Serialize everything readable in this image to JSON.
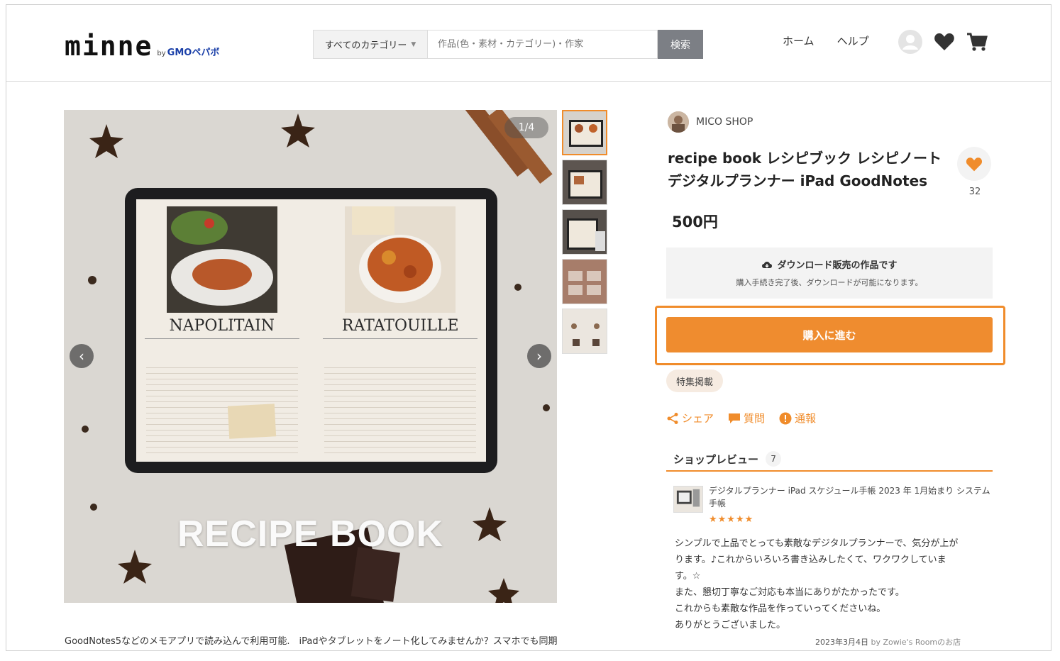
{
  "header": {
    "logo": "minne",
    "logo_by": "by",
    "logo_company": "GMOペパボ",
    "category_select": "すべてのカテゴリー",
    "search_placeholder": "作品(色・素材・カテゴリー)・作家",
    "search_button": "検索",
    "nav": [
      "ホーム",
      "ヘルプ"
    ],
    "icons": [
      "avatar-icon",
      "heart-icon",
      "cart-icon"
    ]
  },
  "gallery": {
    "counter": "1/4",
    "overlay_title": "RECIPE BOOK",
    "left_dish": "NAPOLITAIN",
    "right_dish": "RATATOUILLE",
    "thumb_count": 5
  },
  "product": {
    "shop_name": "MICO SHOP",
    "title_line1": "recipe book レシピブック レシピノート",
    "title_line2": "デジタルプランナー iPad GoodNotes",
    "favorite_count": "32",
    "price": "500円",
    "download_title": "ダウンロード販売の作品です",
    "download_sub": "購入手続き完了後、ダウンロードが可能になります。",
    "buy_button": "購入に進む",
    "feature_tag": "特集掲載",
    "actions": [
      "シェア",
      "質問",
      "通報"
    ]
  },
  "reviews": {
    "label": "ショップレビュー",
    "count": "7",
    "item": {
      "title": "デジタルプランナー iPad スケジュール手帳 2023 年 1月始まり システム手帳",
      "stars": "★★★★★",
      "body": [
        "シンプルで上品でとっても素敵なデジタルプランナーで、気分が上が",
        "ります。♪これからいろいろ書き込みしたくて、ワクワクしていま",
        "す。☆",
        "また、懇切丁寧なご対応も本当にありがたかったです。",
        "これからも素敵な作品を作っていってくださいね。",
        "ありがとうございました。"
      ],
      "date": "2023年3月4日",
      "by": "by Zowie's Roomのお店"
    }
  },
  "description": "GoodNotes5などのメモアプリで読み込んで利用可能.　iPadやタブレットをノート化してみませんか？スマホでも同期",
  "colors": {
    "accent": "#ef8c2f",
    "search_button": "#7c7f85"
  }
}
